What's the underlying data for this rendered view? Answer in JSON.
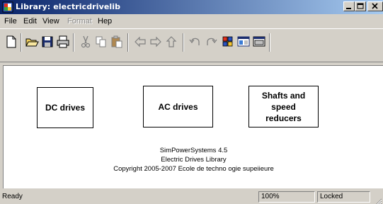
{
  "window": {
    "title": "Library: electricdrivelib",
    "icon": "simulink-library-icon",
    "controls": [
      "minimize-icon",
      "maximize-icon",
      "close-icon"
    ]
  },
  "menubar": {
    "items": [
      {
        "label": "File",
        "enabled": true
      },
      {
        "label": "Edit",
        "enabled": true
      },
      {
        "label": "View",
        "enabled": true
      },
      {
        "label": "Format",
        "enabled": false
      },
      {
        "label": "Hep",
        "enabled": true
      }
    ]
  },
  "toolbar": {
    "buttons": [
      "new-icon",
      "open-icon",
      "save-icon",
      "print-icon",
      "cut-icon",
      "copy-icon",
      "paste-icon",
      "back-icon",
      "forward-icon",
      "up-icon",
      "undo-icon",
      "redo-icon",
      "library-browser-icon",
      "model-explorer-icon",
      "debugger-icon"
    ]
  },
  "canvas": {
    "blocks": [
      {
        "label": "DC drives"
      },
      {
        "label": "AC drives"
      },
      {
        "label": "Shafts and\nspeed\nreducers"
      }
    ],
    "info": {
      "line1": "SimPowerSystems 4.5",
      "line2": "Electric Drives Library",
      "line3": "Copyright  2005-2007 Ecole de techno ogie supeiieure"
    }
  },
  "statusbar": {
    "status": "Ready",
    "zoom": "100%",
    "lock": "Locked"
  }
}
